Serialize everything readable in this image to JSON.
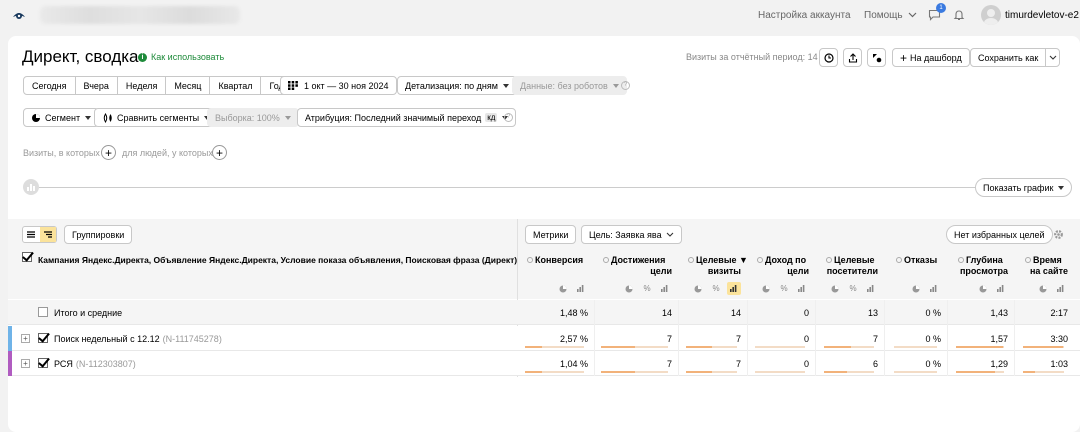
{
  "topbar": {
    "account_settings": "Настройка аккаунта",
    "help": "Помощь",
    "notifications_count": "1",
    "username": "timurdevletov-e2"
  },
  "header": {
    "title": "Директ, сводка",
    "how_to_use": "Как использовать",
    "visits_label": "Визиты за отчётный период: 14",
    "to_dashboard": "На дашборд",
    "save_as": "Сохранить как"
  },
  "periods": [
    "Сегодня",
    "Вчера",
    "Неделя",
    "Месяц",
    "Квартал",
    "Год"
  ],
  "date_range": "1 окт — 30 ноя 2024",
  "detail": "Детализация: по дням",
  "data_filter": "Данные: без роботов",
  "segment": "Сегмент",
  "compare": "Сравнить сегменты",
  "sample": "Выборка: 100%",
  "attribution": "Атрибуция: Последний значимый переход",
  "attribution_badge": "кд",
  "visits_where": "Визиты, в которых",
  "people_where": "для людей, у которых",
  "show_chart": "Показать график",
  "table_toolbar": {
    "groupings": "Группировки",
    "metrics": "Метрики",
    "goal": "Цель: Заявка ява",
    "no_favorites": "Нет избранных целей"
  },
  "dimension_header": "Кампания Яндекс.Директа, Объявление Яндекс.Директа, Условие показа объявления, Поисковая фраза (Директ)",
  "columns": [
    {
      "l1": "Конверсия",
      "l2": ""
    },
    {
      "l1": "Достижения",
      "l2": "цели"
    },
    {
      "l1": "Целевые ▼",
      "l2": "визиты"
    },
    {
      "l1": "Доход по",
      "l2": "цели"
    },
    {
      "l1": "Целевые",
      "l2": "посетители"
    },
    {
      "l1": "Отказы",
      "l2": ""
    },
    {
      "l1": "Глубина",
      "l2": "просмотра"
    },
    {
      "l1": "Время",
      "l2": "на сайте"
    }
  ],
  "rows": [
    {
      "name": "Итого и средние",
      "id": "",
      "values": [
        "1,48 %",
        "14",
        "14",
        "0",
        "13",
        "0 %",
        "1,43",
        "2:17"
      ]
    },
    {
      "name": "Поиск недельный с 12.12",
      "id": "(N-111745278)",
      "values": [
        "2,57 %",
        "7",
        "7",
        "0",
        "7",
        "0 %",
        "1,57",
        "3:30"
      ],
      "bars": [
        0.28,
        0.5,
        0.5,
        0,
        0.54,
        0,
        0.98,
        0.98
      ]
    },
    {
      "name": "РСЯ",
      "id": "(N-112303807)",
      "values": [
        "1,04 %",
        "7",
        "7",
        "0",
        "6",
        "0 %",
        "1,29",
        "1:03"
      ],
      "bars": [
        0.28,
        0.5,
        0.5,
        0,
        0.46,
        0,
        0.82,
        0.3
      ]
    }
  ],
  "colors": {
    "row1_marker": "#6fb3e8",
    "row2_marker": "#b05cc0",
    "accent": "#fbe39b",
    "bar": "#f2b27a"
  }
}
